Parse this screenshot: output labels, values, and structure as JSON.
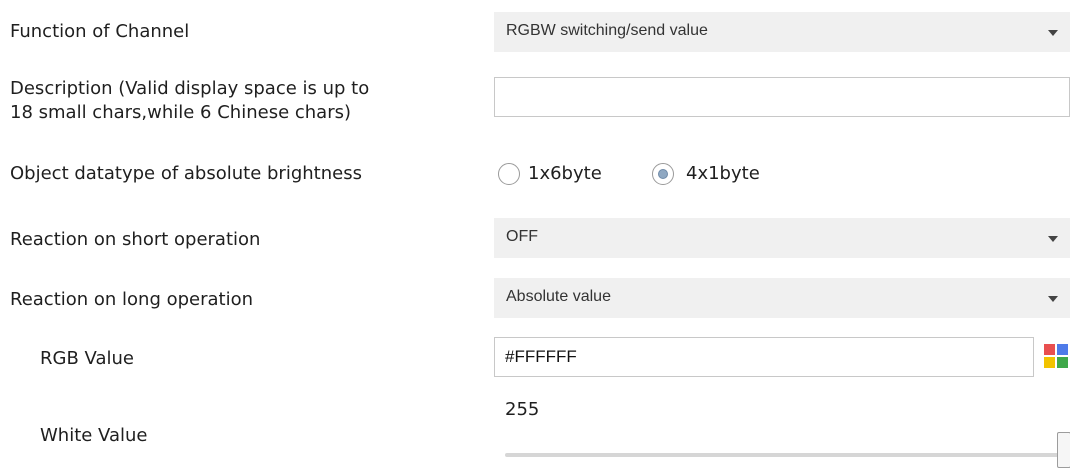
{
  "params": {
    "function_of_channel": {
      "label": "Function of Channel",
      "value": "RGBW switching/send value"
    },
    "description": {
      "label_line1": "Description (Valid display space is up to",
      "label_line2": "18 small chars,while 6 Chinese chars)",
      "value": ""
    },
    "object_datatype": {
      "label": "Object datatype of absolute brightness",
      "options": [
        {
          "label": "1x6byte",
          "checked": false
        },
        {
          "label": "4x1byte",
          "checked": true
        }
      ]
    },
    "short_operation": {
      "label": "Reaction on short operation",
      "value": "OFF"
    },
    "long_operation": {
      "label": "Reaction on long operation",
      "value": "Absolute value"
    },
    "rgb_value": {
      "label": "RGB Value",
      "value": "#FFFFFF"
    },
    "white_value": {
      "label": "White Value",
      "value": "255",
      "level_fraction": 1.0
    }
  },
  "colors": {
    "dropdown_bg": "#f0f0f0",
    "radio_selected": "#8fa8c2",
    "palette": [
      "#e94f4f",
      "#4f7be9",
      "#f2c300",
      "#3fa84a"
    ]
  }
}
